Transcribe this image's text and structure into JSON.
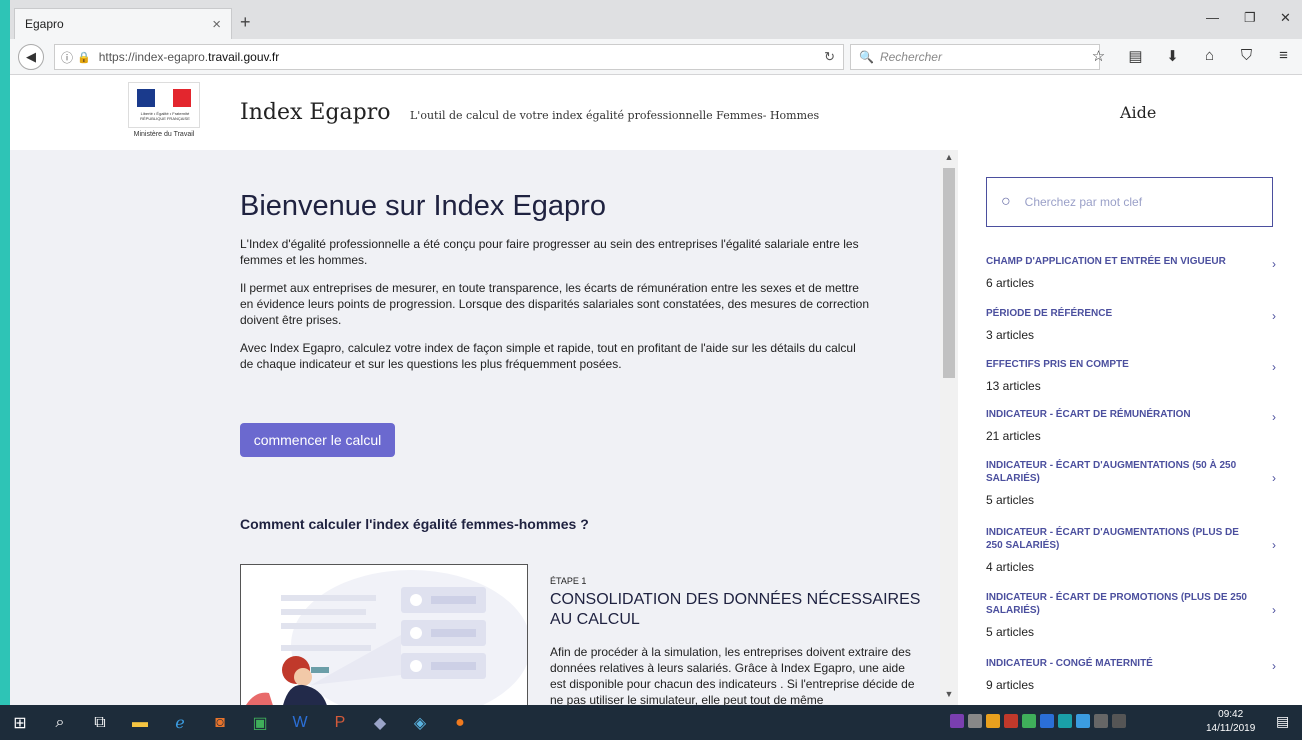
{
  "browser": {
    "tab_title": "Egapro",
    "tab_close": "×",
    "new_tab": "+",
    "url_prefix": "https://index-egapro.",
    "url_host": "travail.gouv.fr",
    "search_placeholder": "Rechercher"
  },
  "header": {
    "ministry_caption": "Ministère du Travail",
    "flag_motto": "Liberté • Égalité • Fraternité RÉPUBLIQUE FRANÇAISE",
    "brand": "Index Egapro",
    "tagline": "L'outil de calcul de votre index égalité professionnelle Femmes- Hommes",
    "help_link": "Aide"
  },
  "main": {
    "title": "Bienvenue sur Index Egapro",
    "paragraphs": [
      "L'Index d'égalité professionnelle a été conçu pour faire progresser au sein des entreprises l'égalité salariale entre les femmes et les hommes.",
      "Il permet aux entreprises de mesurer, en toute transparence, les écarts de rémunération entre les sexes et de mettre en évidence leurs points de progression. Lorsque des disparités salariales sont constatées, des mesures de correction doivent être prises.",
      "Avec Index Egapro, calculez votre index de façon simple et rapide, tout en profitant de l'aide sur les détails du calcul de chaque indicateur et sur les questions les plus fréquemment posées."
    ],
    "cta_label": "commencer le calcul",
    "how_title": "Comment calculer l'index égalité femmes-hommes ?",
    "step_label": "ÉTAPE 1",
    "step_title": "CONSOLIDATION DES DONNÉES NÉCESSAIRES AU CALCUL",
    "step_text": "Afin de procéder à la simulation, les entreprises doivent extraire des données relatives à leurs salariés. Grâce à Index Egapro, une aide est disponible pour chacun des indicateurs . Si l'entreprise décide de ne pas utiliser le simulateur, elle peut tout de même"
  },
  "sidebar": {
    "search_placeholder": "Cherchez par mot clef",
    "categories": [
      {
        "title": "CHAMP D'APPLICATION ET ENTRÉE EN VIGUEUR",
        "count": "6 articles"
      },
      {
        "title": "PÉRIODE DE RÉFÉRENCE",
        "count": "3 articles"
      },
      {
        "title": "EFFECTIFS PRIS EN COMPTE",
        "count": "13 articles"
      },
      {
        "title": "INDICATEUR - ÉCART DE RÉMUNÉRATION",
        "count": "21 articles"
      },
      {
        "title": "INDICATEUR - ÉCART D'AUGMENTATIONS (50 À 250 SALARIÉS)",
        "count": "5 articles"
      },
      {
        "title": "INDICATEUR - ÉCART D'AUGMENTATIONS (PLUS DE 250 SALARIÉS)",
        "count": "4 articles"
      },
      {
        "title": "INDICATEUR - ÉCART DE PROMOTIONS (PLUS DE 250 SALARIÉS)",
        "count": "5 articles"
      },
      {
        "title": "INDICATEUR - CONGÉ MATERNITÉ",
        "count": "9 articles"
      }
    ]
  },
  "taskbar": {
    "time": "09:42",
    "date": "14/11/2019"
  },
  "colors": {
    "accent": "#6b69cf",
    "category": "#4b4f9e",
    "page_bg": "#f0f1f5"
  }
}
